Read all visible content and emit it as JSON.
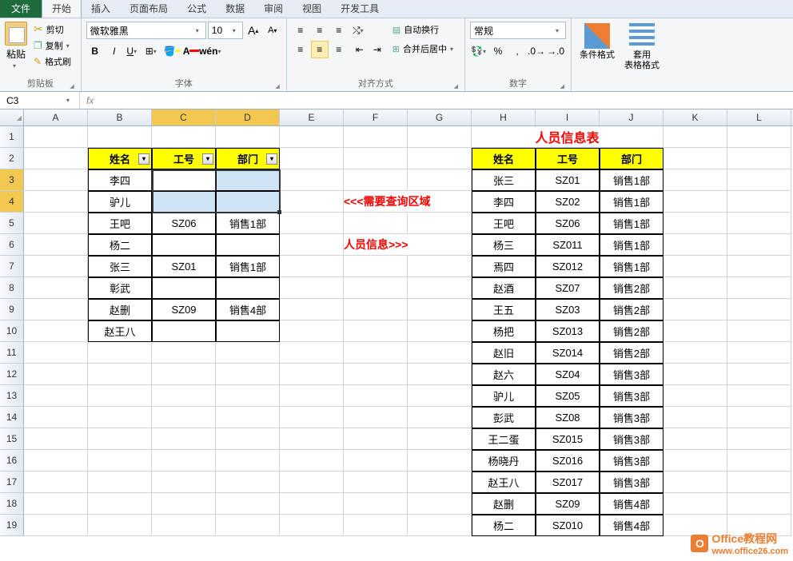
{
  "tabs": {
    "file": "文件",
    "home": "开始",
    "insert": "插入",
    "layout": "页面布局",
    "formulas": "公式",
    "data": "数据",
    "review": "审阅",
    "view": "视图",
    "dev": "开发工具"
  },
  "ribbon": {
    "paste": "粘贴",
    "cut": "剪切",
    "copy": "复制",
    "format_painter": "格式刷",
    "clipboard": "剪贴板",
    "font_name": "微软雅黑",
    "font_size": "10",
    "font_group": "字体",
    "wrap": "自动换行",
    "merge": "合并后居中",
    "align_group": "对齐方式",
    "number_format": "常规",
    "number_group": "数字",
    "cond_format": "条件格式",
    "table_format": "套用\n表格格式"
  },
  "namebox": "C3",
  "cols": [
    "A",
    "B",
    "C",
    "D",
    "E",
    "F",
    "G",
    "H",
    "I",
    "J",
    "K",
    "L"
  ],
  "rows": [
    "1",
    "2",
    "3",
    "4",
    "5",
    "6",
    "7",
    "8",
    "9",
    "10",
    "11",
    "12",
    "13",
    "14",
    "15",
    "16",
    "17",
    "18",
    "19"
  ],
  "left_table": {
    "headers": [
      "姓名",
      "工号",
      "部门"
    ],
    "rows": [
      [
        "李四",
        "",
        ""
      ],
      [
        "驴儿",
        "",
        ""
      ],
      [
        "王吧",
        "SZ06",
        "销售1部"
      ],
      [
        "杨二",
        "",
        ""
      ],
      [
        "张三",
        "SZ01",
        "销售1部"
      ],
      [
        "彰武",
        "",
        ""
      ],
      [
        "赵删",
        "SZ09",
        "销售4部"
      ],
      [
        "赵王八",
        "",
        ""
      ]
    ]
  },
  "labels": {
    "query": "<<<需要查询区域",
    "info": "人员信息>>>"
  },
  "right_table": {
    "title": "人员信息表",
    "headers": [
      "姓名",
      "工号",
      "部门"
    ],
    "rows": [
      [
        "张三",
        "SZ01",
        "销售1部"
      ],
      [
        "李四",
        "SZ02",
        "销售1部"
      ],
      [
        "王吧",
        "SZ06",
        "销售1部"
      ],
      [
        "杨三",
        "SZ011",
        "销售1部"
      ],
      [
        "焉四",
        "SZ012",
        "销售1部"
      ],
      [
        "赵酒",
        "SZ07",
        "销售2部"
      ],
      [
        "王五",
        "SZ03",
        "销售2部"
      ],
      [
        "杨把",
        "SZ013",
        "销售2部"
      ],
      [
        "赵旧",
        "SZ014",
        "销售2部"
      ],
      [
        "赵六",
        "SZ04",
        "销售3部"
      ],
      [
        "驴儿",
        "SZ05",
        "销售3部"
      ],
      [
        "彭武",
        "SZ08",
        "销售3部"
      ],
      [
        "王二蛋",
        "SZ015",
        "销售3部"
      ],
      [
        "杨晓丹",
        "SZ016",
        "销售3部"
      ],
      [
        "赵王八",
        "SZ017",
        "销售3部"
      ],
      [
        "赵删",
        "SZ09",
        "销售4部"
      ],
      [
        "杨二",
        "SZ010",
        "销售4部"
      ]
    ]
  },
  "watermark": {
    "brand": "Office",
    "suffix": "教程网",
    "url": "www.office26.com"
  }
}
